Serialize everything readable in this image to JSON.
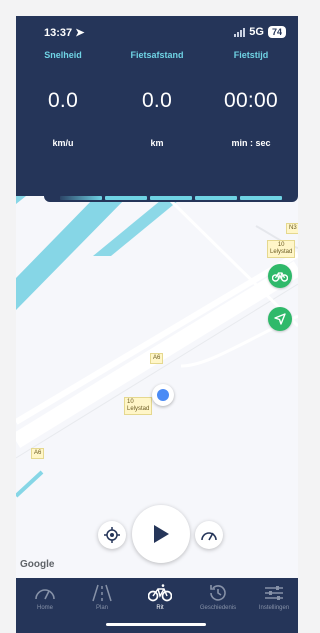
{
  "status": {
    "time": "13:37",
    "network": "5G",
    "battery": "74"
  },
  "stats": [
    {
      "label": "Snelheid",
      "value": "0.0",
      "unit": "km/u"
    },
    {
      "label": "Fietsafstand",
      "value": "0.0",
      "unit": "km"
    },
    {
      "label": "Fietstijd",
      "value": "00:00",
      "unit": "min : sec"
    }
  ],
  "map": {
    "labels": {
      "a6_top": "A6",
      "a6_bottom": "A6",
      "n3": "N3",
      "road10_right_number": "10",
      "road10_right_name": "Lelystad",
      "road10_center_number": "10",
      "road10_center_name": "Lelystad"
    },
    "google": "Google",
    "icons": {
      "bike": "bike-icon",
      "navigate": "navigation-arrow-icon",
      "recenter": "crosshair-icon",
      "play": "play-icon",
      "speed": "speedometer-icon"
    }
  },
  "tabs": [
    {
      "label": "Home",
      "icon": "speedometer-icon"
    },
    {
      "label": "Plan",
      "icon": "road-icon"
    },
    {
      "label": "Rit",
      "icon": "bike-icon"
    },
    {
      "label": "Geschiedenis",
      "icon": "history-icon"
    },
    {
      "label": "Instellingen",
      "icon": "sliders-icon"
    }
  ],
  "colors": {
    "header": "#253559",
    "accent": "#6fd3e4",
    "green": "#2fb96a",
    "location": "#4b8bf5"
  }
}
